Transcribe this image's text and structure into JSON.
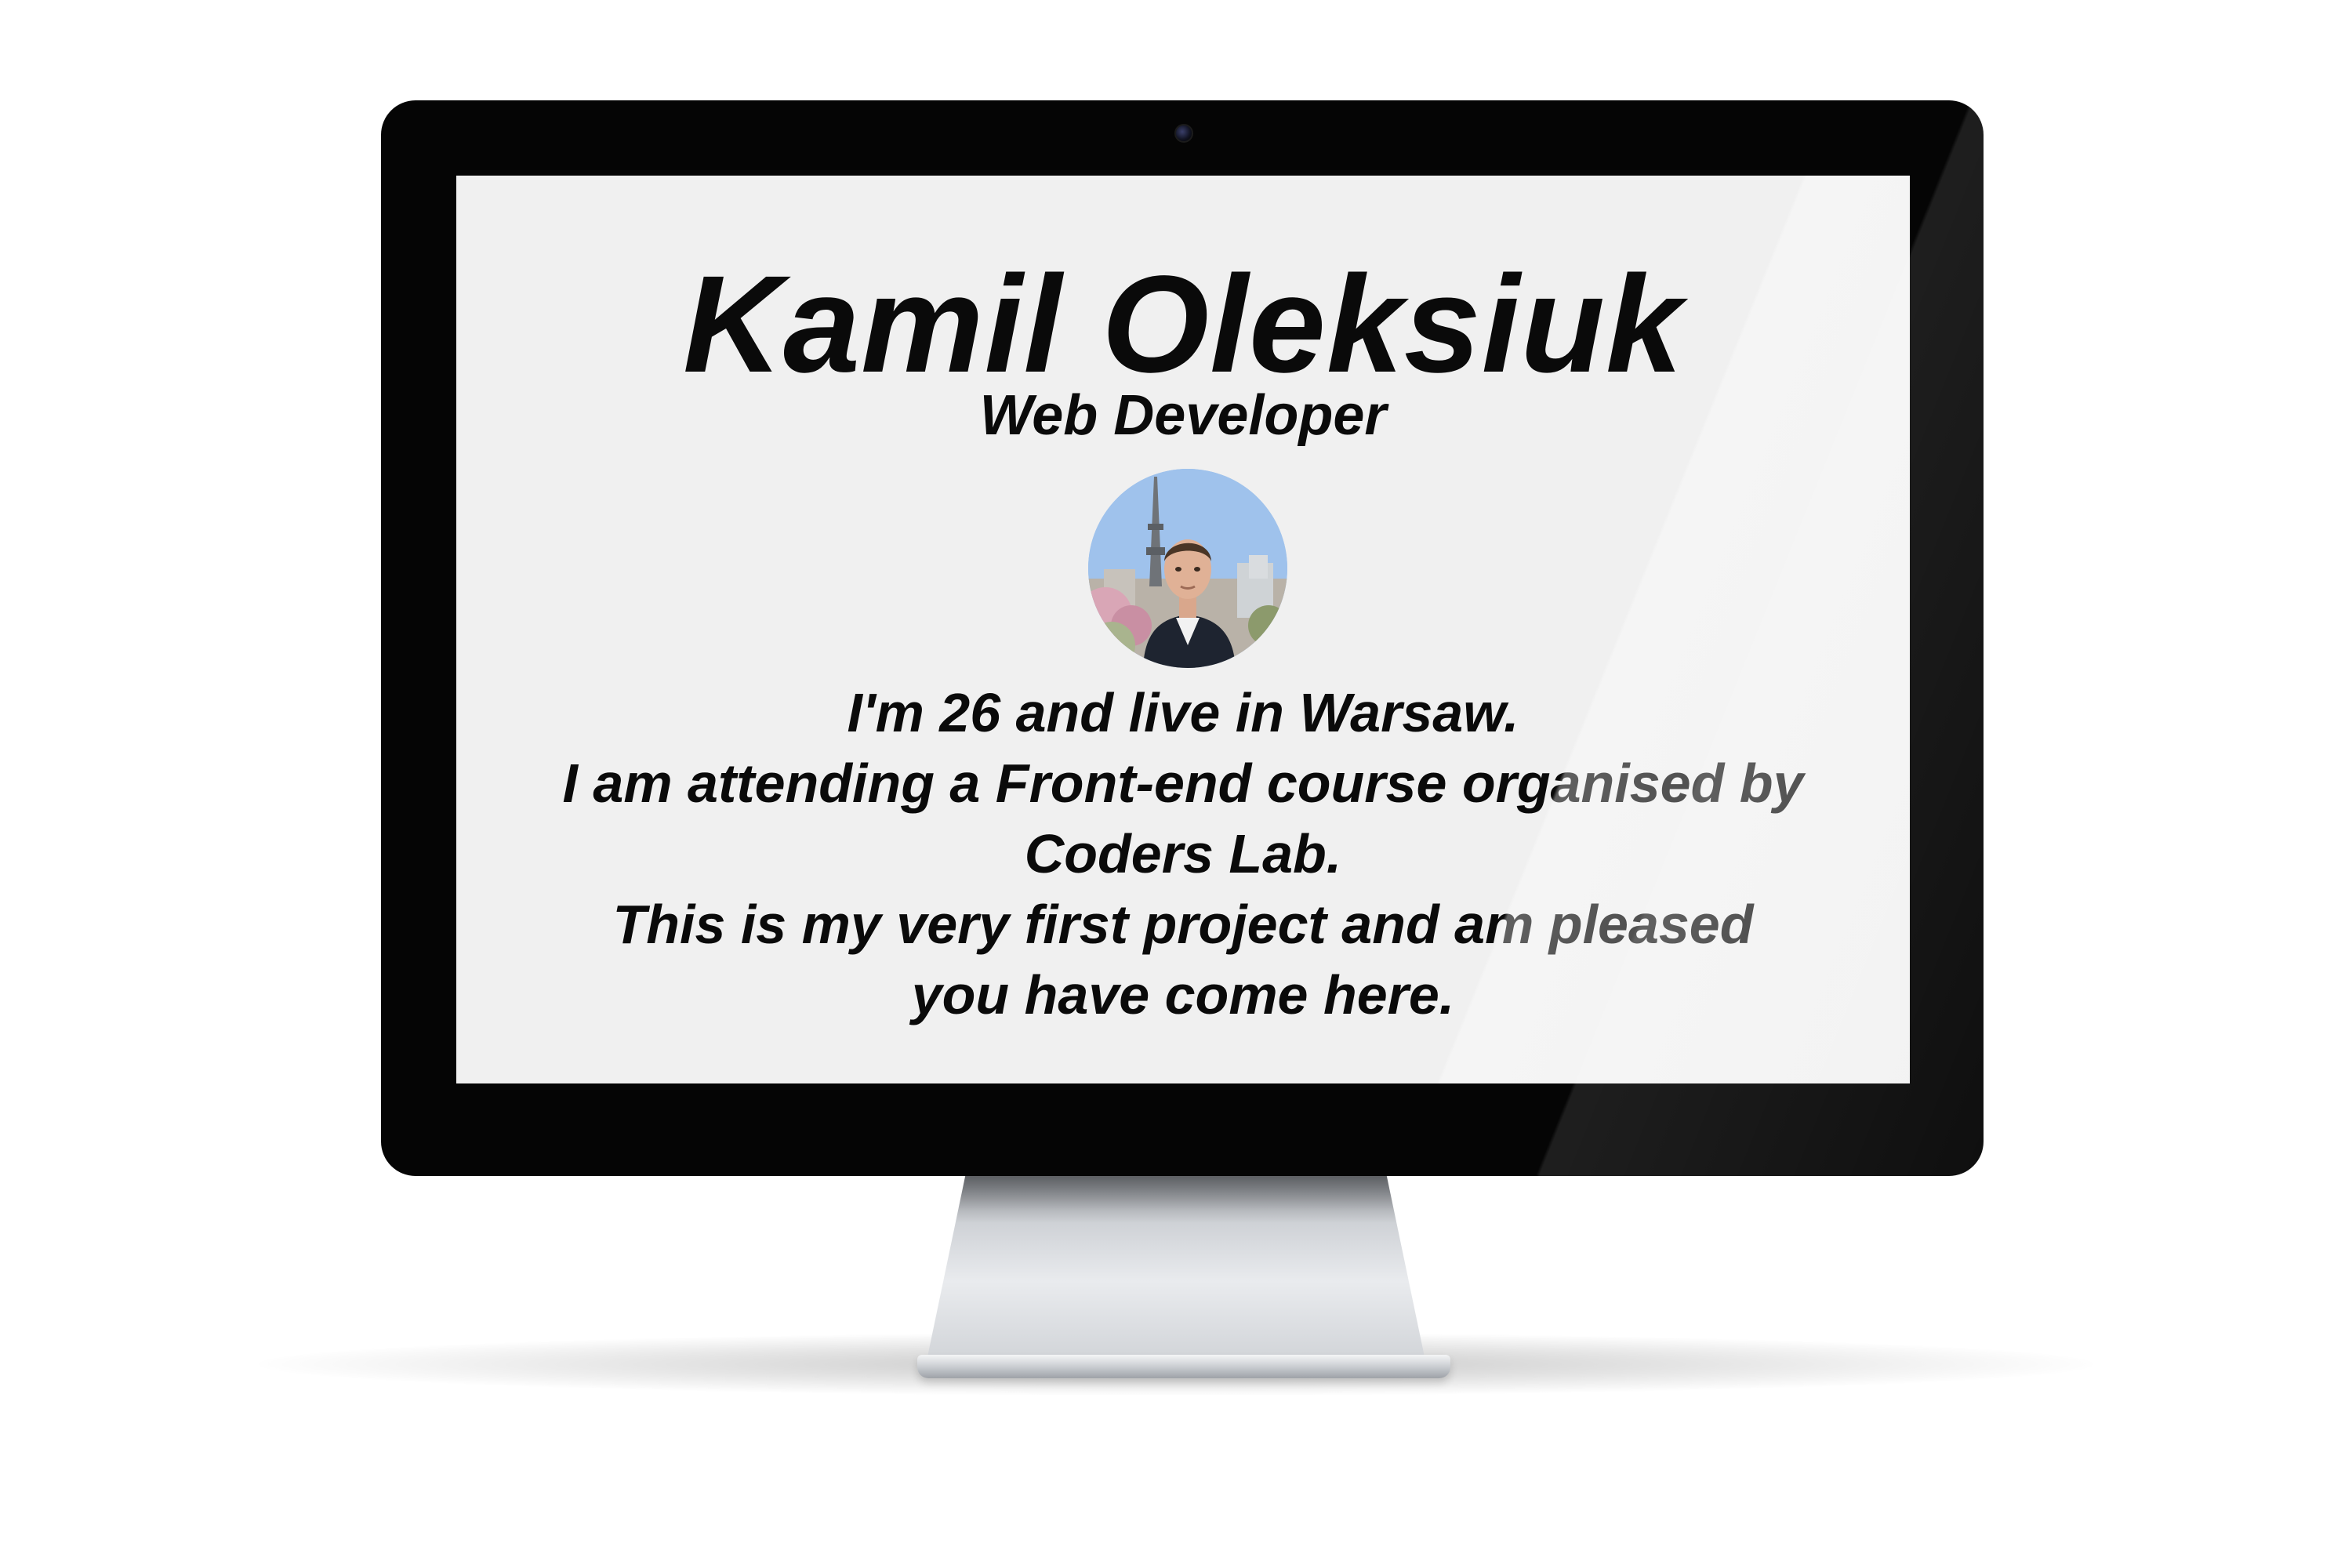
{
  "profile": {
    "name": "Kamil Oleksiuk",
    "role": "Web Developer",
    "avatar": "profile-photo"
  },
  "bio": {
    "lines": [
      "I'm 26 and live in Warsaw.",
      "I am attending a Front-end course organised by",
      "Coders Lab.",
      "This is my very first project and am pleased",
      "you have come here."
    ]
  },
  "colors": {
    "screen_background": "#f0f0f0",
    "bezel": "#050505",
    "text": "#0a0a0a"
  }
}
